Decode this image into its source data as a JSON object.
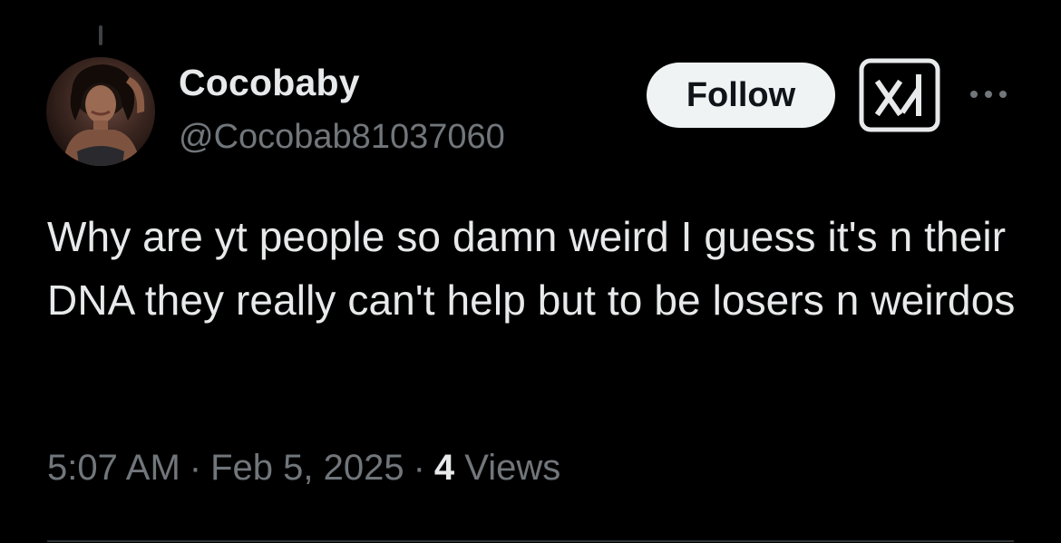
{
  "user": {
    "display_name": "Cocobaby",
    "handle": "@Cocobab81037060"
  },
  "actions": {
    "follow_label": "Follow",
    "grok_icon": "grok-icon",
    "more_icon": "more-icon"
  },
  "tweet": {
    "text": "Why are yt people so damn weird I guess it's n their DNA they really can't help but to be losers n weirdos"
  },
  "meta": {
    "time": "5:07 AM",
    "separator": "·",
    "date": "Feb 5, 2025",
    "views_count": "4",
    "views_label": "Views"
  },
  "colors": {
    "background": "#000000",
    "text_primary": "#e7e9ea",
    "text_secondary": "#71767b",
    "follow_button_bg": "#eff3f4",
    "divider": "#2f3336"
  }
}
